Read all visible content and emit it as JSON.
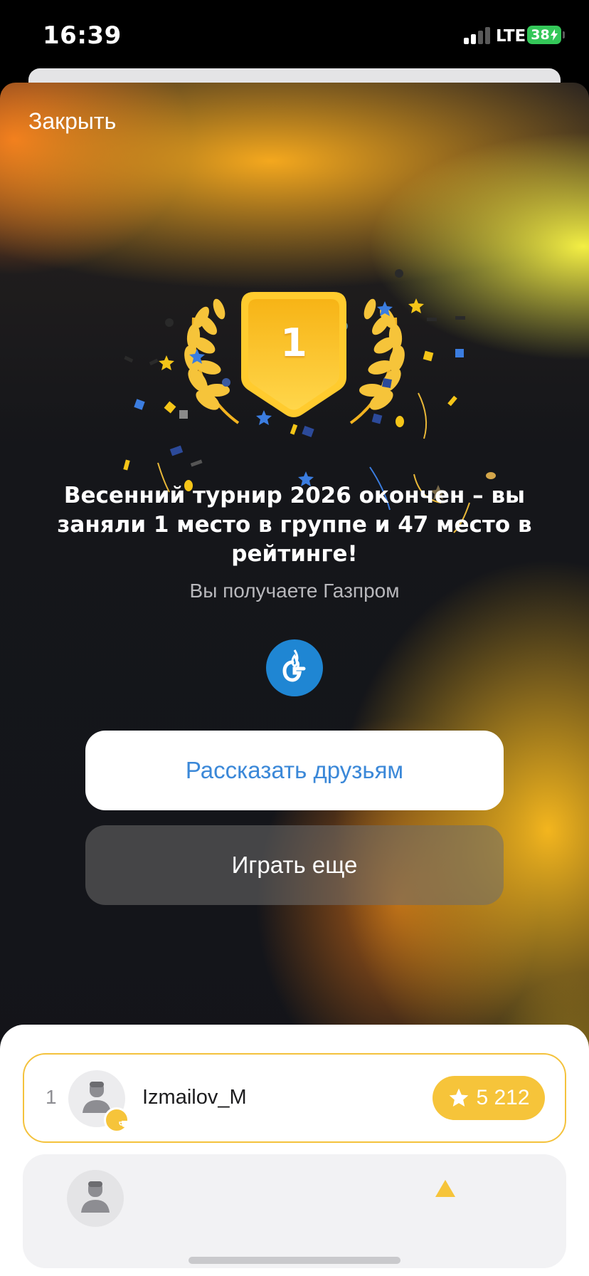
{
  "status_bar": {
    "time": "16:39",
    "network": "LTE",
    "battery": "38"
  },
  "modal": {
    "close_label": "Закрыть",
    "place": "1",
    "headline": "Весенний турнир 2026 окончен – вы заняли 1 место в группе и 47 место в рейтинге!",
    "reward_text": "Вы получаете Газпром",
    "reward_icon": "gazprom-logo-icon",
    "share_button": "Рассказать друзьям",
    "play_again_button": "Играть еще"
  },
  "leaderboard": {
    "rows": [
      {
        "rank": "1",
        "name": "Izmailov_M",
        "score": "5 212"
      }
    ]
  },
  "colors": {
    "accent_blue": "#3b88d8",
    "gold": "#f6c43a",
    "gazprom_blue": "#1f86d3"
  }
}
